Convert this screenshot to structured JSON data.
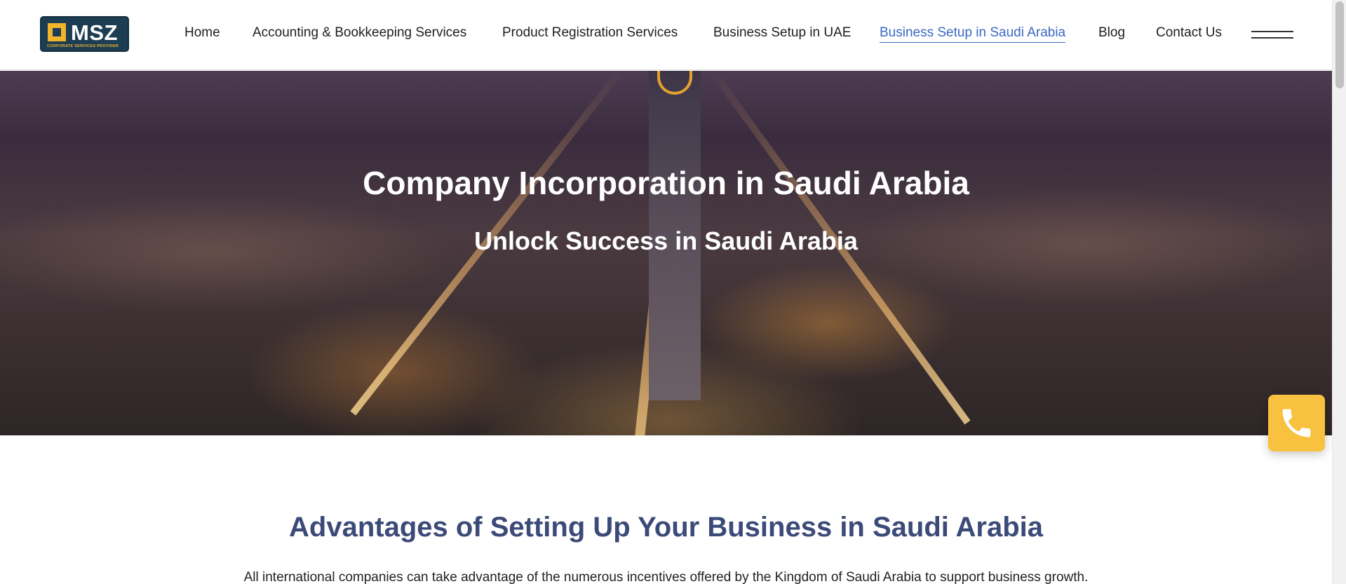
{
  "logo": {
    "text": "MSZ",
    "subtext": "CORPORATE SERVICES PROVIDER"
  },
  "nav": {
    "items": [
      {
        "label": "Home"
      },
      {
        "label": "Accounting & Bookkeeping Services"
      },
      {
        "label": "Product Registration Services"
      },
      {
        "label": "Business Setup in UAE"
      },
      {
        "label": "Business Setup in Saudi Arabia"
      },
      {
        "label": "Blog"
      },
      {
        "label": "Contact Us"
      }
    ],
    "active_index": 4
  },
  "hero": {
    "title": "Company Incorporation in Saudi Arabia",
    "subtitle": "Unlock Success in Saudi Arabia"
  },
  "content": {
    "heading": "Advantages of Setting Up Your Business in Saudi Arabia",
    "intro": "All international companies can take advantage of the numerous incentives offered by the Kingdom of Saudi Arabia to support business growth."
  },
  "icons": {
    "menu": "hamburger-menu-icon",
    "phone": "phone-icon"
  },
  "colors": {
    "active_link": "#3a68c4",
    "heading": "#3b4a78",
    "phone_button": "#f9c140",
    "logo_bg": "#1c3d52",
    "logo_accent": "#f1b52c"
  }
}
